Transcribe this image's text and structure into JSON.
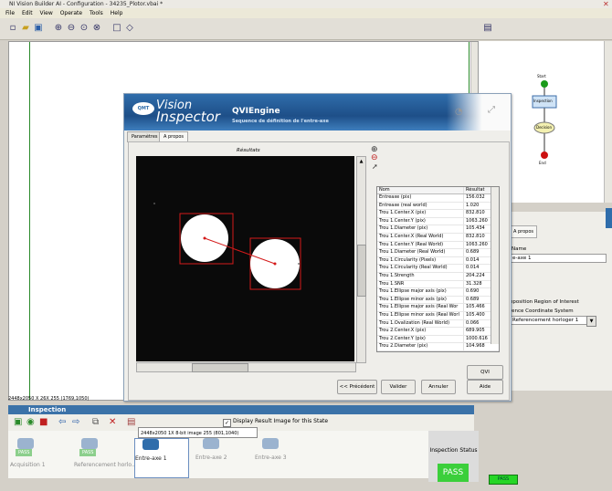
{
  "window": {
    "title": "NI Vision Builder AI - Configuration - 34235_Plotor.vbai *"
  },
  "menu": [
    "File",
    "Edit",
    "View",
    "Operate",
    "Tools",
    "Help"
  ],
  "flowchart": {
    "start": "Start",
    "inspection": "Inspection",
    "decision": "Decision",
    "end": "End"
  },
  "status_line": "2448x2050 X 26X 255  (1769,1050)",
  "inspection_panel": {
    "title": "Inspection",
    "display_checkbox_label": "Display Result Image for this State",
    "states": [
      {
        "label": "Acquisition 1",
        "pass": "PASS"
      },
      {
        "label": "Referencement horlo...",
        "pass": "PASS"
      },
      {
        "label": "Entre-axe 1",
        "pass": ""
      },
      {
        "label": "Entre-axe 2",
        "pass": ""
      },
      {
        "label": "Entre-axe 3",
        "pass": ""
      }
    ],
    "status_title": "Inspection Status",
    "status_value": "PASS",
    "small_pass": "PASS"
  },
  "dialog": {
    "brand_line1": "Vision",
    "brand_line2": "Inspector",
    "logo_text": "QMT",
    "engine_title": "QVIEngine",
    "engine_subtitle": "Sequence de définition de l'entre-axe",
    "tabs": [
      "Paramètres",
      "A propos"
    ],
    "image_title": "Résultats",
    "image_info": "2448x2050 1X 8-bit image 255   (801,1040)",
    "table_headers": [
      "Nom",
      "Résultat"
    ],
    "rows": [
      [
        "Entreaxe (pix)",
        "156.032"
      ],
      [
        "Entreaxe (real world)",
        "1.020"
      ],
      [
        "Trou 1.Center.X (pix)",
        "832.810"
      ],
      [
        "Trou 1.Center.Y (pix)",
        "1063.260"
      ],
      [
        "Trou 1.Diameter (pix)",
        "105.434"
      ],
      [
        "Trou 1.Center.X (Real World)",
        "832.810"
      ],
      [
        "Trou 1.Center.Y (Real World)",
        "1063.260"
      ],
      [
        "Trou 1.Diameter (Real World)",
        "0.689"
      ],
      [
        "Trou 1.Circularity (Pixels)",
        "0.014"
      ],
      [
        "Trou 1.Circularity (Real World)",
        "0.014"
      ],
      [
        "Trou 1.Strength",
        "204.224"
      ],
      [
        "Trou 1.SNR",
        "31.328"
      ],
      [
        "Trou 1.Ellipse major axis (pix)",
        "0.690"
      ],
      [
        "Trou 1.Ellipse minor axis (pix)",
        "0.689"
      ],
      [
        "Trou 1.Ellipse major axis (Real Wor",
        "105.466"
      ],
      [
        "Trou 1.Ellipse minor axis (Real Worl",
        "105.400"
      ],
      [
        "Trou 1.Ovalization (Real World)",
        "0.066"
      ],
      [
        "Trou 2.Center.X (pix)",
        "689.905"
      ],
      [
        "Trou 2.Center.Y (pix)",
        "1000.616"
      ],
      [
        "Trou 2.Diameter (pix)",
        "104.968"
      ]
    ],
    "buttons": {
      "qvi": "QVI",
      "prev": "<< Précédent",
      "validate": "Valider",
      "cancel": "Annuler",
      "help": "Aide"
    }
  },
  "right_props": {
    "tab": "A propos",
    "name_label": "Name",
    "name_value": "e-axe 1",
    "region_label": "eposition Region of Interest",
    "coord_label": "rence Coordinate System",
    "coord_value": "Referencement horloger 1"
  }
}
